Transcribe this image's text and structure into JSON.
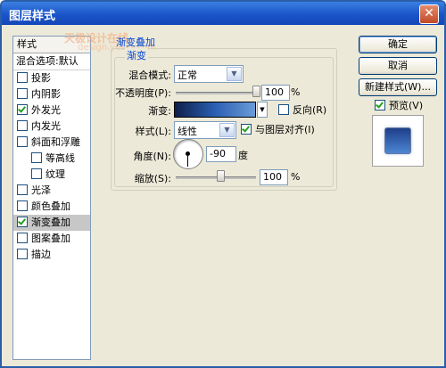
{
  "window": {
    "title": "图层样式",
    "close_glyph": "✕"
  },
  "watermark": {
    "line1": "天极设计在线",
    "line2": "design.yesky.com"
  },
  "styles_panel": {
    "header": "样式",
    "blend_item": "混合选项:默认",
    "items": [
      {
        "label": "投影",
        "checked": false,
        "sub": false,
        "selected": false
      },
      {
        "label": "内阴影",
        "checked": false,
        "sub": false,
        "selected": false
      },
      {
        "label": "外发光",
        "checked": true,
        "sub": false,
        "selected": false
      },
      {
        "label": "内发光",
        "checked": false,
        "sub": false,
        "selected": false
      },
      {
        "label": "斜面和浮雕",
        "checked": false,
        "sub": false,
        "selected": false
      },
      {
        "label": "等高线",
        "checked": false,
        "sub": true,
        "selected": false
      },
      {
        "label": "纹理",
        "checked": false,
        "sub": true,
        "selected": false
      },
      {
        "label": "光泽",
        "checked": false,
        "sub": false,
        "selected": false
      },
      {
        "label": "颜色叠加",
        "checked": false,
        "sub": false,
        "selected": false
      },
      {
        "label": "渐变叠加",
        "checked": true,
        "sub": false,
        "selected": true
      },
      {
        "label": "图案叠加",
        "checked": false,
        "sub": false,
        "selected": false
      },
      {
        "label": "描边",
        "checked": false,
        "sub": false,
        "selected": false
      }
    ]
  },
  "gradient_overlay": {
    "group_title": "渐变叠加",
    "sub_title": "渐变",
    "blend_mode_label": "混合模式:",
    "blend_mode_value": "正常",
    "opacity_label": "不透明度(P):",
    "opacity_value": "100",
    "opacity_unit": "%",
    "opacity_level": 1.0,
    "gradient_label": "渐变:",
    "reverse_label": "反向(R)",
    "reverse_checked": false,
    "style_label": "样式(L):",
    "style_value": "线性",
    "align_label": "与图层对齐(I)",
    "align_checked": true,
    "angle_label": "角度(N):",
    "angle_value": "-90",
    "angle_unit": "度",
    "scale_label": "缩放(S):",
    "scale_value": "100",
    "scale_unit": "%",
    "scale_level": 0.55
  },
  "buttons": {
    "ok": "确定",
    "cancel": "取消",
    "new_style": "新建样式(W)...",
    "preview_label": "预览(V)",
    "preview_checked": true
  },
  "colors": {
    "gradient_start": "#0d1f49",
    "gradient_end": "#6a9bd9",
    "title_bar": "#1a55c9",
    "group_title": "#0046d5"
  }
}
